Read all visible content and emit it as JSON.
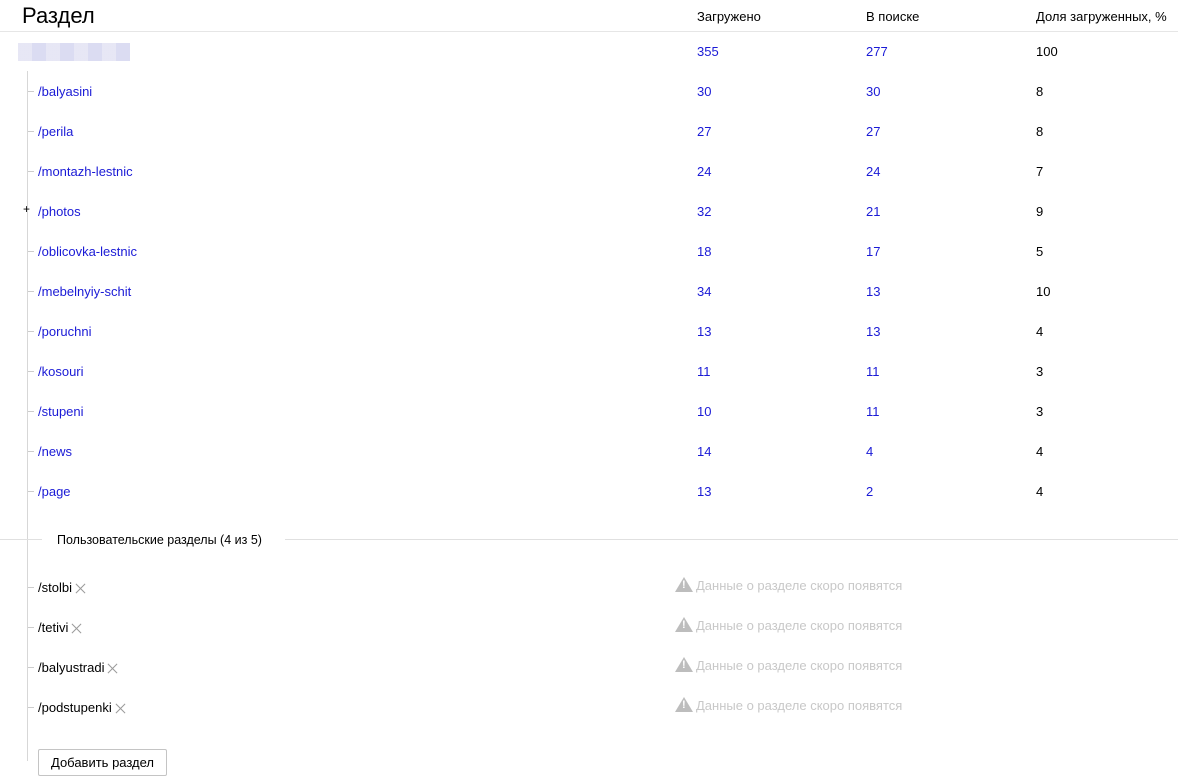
{
  "header": {
    "title": "Раздел",
    "col_loaded": "Загружено",
    "col_in_search": "В поиске",
    "col_share": "Доля загруженных, %"
  },
  "root": {
    "loaded": "355",
    "in_search": "277",
    "share": "100"
  },
  "sections": [
    {
      "name": "/balyasini",
      "loaded": "30",
      "in_search": "30",
      "share": "8",
      "expandable": false
    },
    {
      "name": "/perila",
      "loaded": "27",
      "in_search": "27",
      "share": "8",
      "expandable": false
    },
    {
      "name": "/montazh-lestnic",
      "loaded": "24",
      "in_search": "24",
      "share": "7",
      "expandable": false
    },
    {
      "name": "/photos",
      "loaded": "32",
      "in_search": "21",
      "share": "9",
      "expandable": true
    },
    {
      "name": "/oblicovka-lestnic",
      "loaded": "18",
      "in_search": "17",
      "share": "5",
      "expandable": false
    },
    {
      "name": "/mebelnyiy-schit",
      "loaded": "34",
      "in_search": "13",
      "share": "10",
      "expandable": false
    },
    {
      "name": "/poruchni",
      "loaded": "13",
      "in_search": "13",
      "share": "4",
      "expandable": false
    },
    {
      "name": "/kosouri",
      "loaded": "11",
      "in_search": "11",
      "share": "3",
      "expandable": false
    },
    {
      "name": "/stupeni",
      "loaded": "10",
      "in_search": "11",
      "share": "3",
      "expandable": false
    },
    {
      "name": "/news",
      "loaded": "14",
      "in_search": "4",
      "share": "4",
      "expandable": false
    },
    {
      "name": "/page",
      "loaded": "13",
      "in_search": "2",
      "share": "4",
      "expandable": false
    }
  ],
  "expand_symbol": "+",
  "user_sections": {
    "label": "Пользовательские разделы (4 из 5)",
    "notice": "Данные о разделе скоро появятся",
    "items": [
      {
        "name": "/stolbi"
      },
      {
        "name": "/tetivi"
      },
      {
        "name": "/balyustradi"
      },
      {
        "name": "/podstupenki"
      }
    ]
  },
  "add_button_label": "Добавить раздел",
  "icons": {
    "remove": "close-icon",
    "notice": "warning-icon",
    "expand": "plus-icon"
  },
  "colors": {
    "link": "#1a1ad6",
    "muted": "#c8c8c8",
    "divider": "#e0e0e0"
  }
}
